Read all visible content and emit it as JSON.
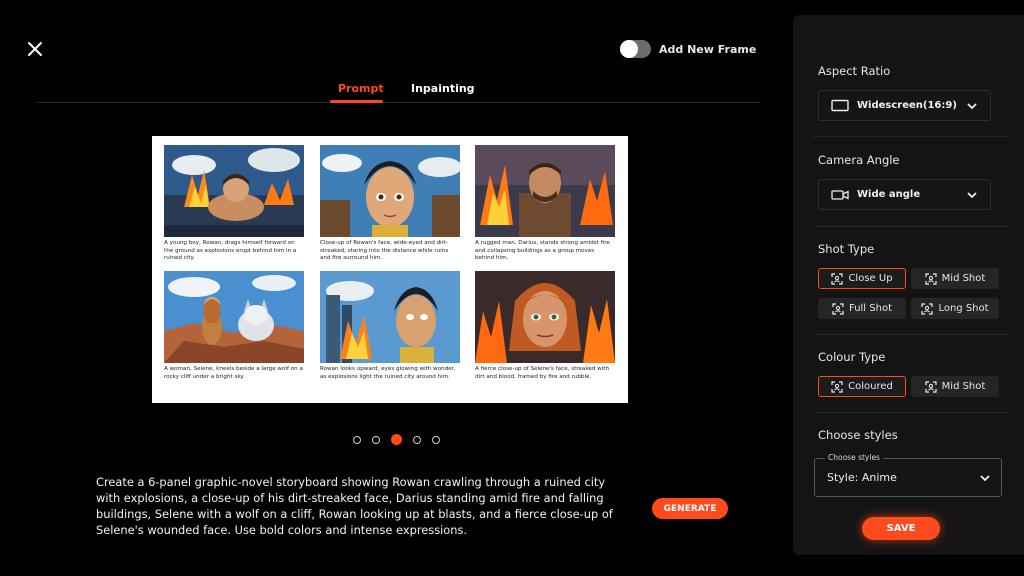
{
  "header": {
    "toggle_label": "Add New Frame",
    "toggle_on": false
  },
  "tabs": [
    {
      "label": "Prompt",
      "active": true
    },
    {
      "label": "Inpainting",
      "active": false
    }
  ],
  "storyboard": {
    "panels": [
      {
        "caption": "A young boy, Rowan, drags himself forward on the ground as explosions erupt behind him in a ruined city.",
        "icon": "boy-crawling-explosion-image"
      },
      {
        "caption": "Close-up of Rowan's face, wide-eyed and dirt-streaked, staring into the distance while ruins and fire surround him.",
        "icon": "boy-face-closeup-image"
      },
      {
        "caption": "A rugged man, Darius, stands strong amidst fire and collapsing buildings as a group moves behind him.",
        "icon": "rugged-man-fire-image"
      },
      {
        "caption": "A woman, Selene, kneels beside a large wolf on a rocky cliff under a bright sky.",
        "icon": "woman-wolf-cliff-image"
      },
      {
        "caption": "Rowan looks upward, eyes glowing with wonder, as explosions light the ruined city around him.",
        "icon": "boy-looking-up-image"
      },
      {
        "caption": "A fierce close-up of Selene's face, streaked with dirt and blood, framed by fire and rubble.",
        "icon": "woman-face-closeup-image"
      }
    ]
  },
  "pagination": {
    "count": 5,
    "active_index": 2
  },
  "prompt": {
    "text": "Create a 6-panel graphic-novel storyboard showing Rowan crawling through a ruined city with explosions, a close-up of his dirt-streaked face, Darius standing amid fire and falling buildings, Selene with a wolf on a cliff, Rowan looking up at blasts, and a fierce close-up of Selene's wounded face. Use bold colors and intense expressions."
  },
  "generate_label": "GENERATE",
  "sidebar": {
    "aspect_ratio": {
      "title": "Aspect Ratio",
      "value": "Widescreen(16:9)",
      "icon": "widescreen-icon"
    },
    "camera_angle": {
      "title": "Camera Angle",
      "value": "Wide angle",
      "icon": "camera-icon"
    },
    "shot_type": {
      "title": "Shot Type",
      "options": [
        {
          "label": "Close Up",
          "selected": true
        },
        {
          "label": "Mid Shot",
          "selected": false
        },
        {
          "label": "Full Shot",
          "selected": false
        },
        {
          "label": "Long Shot",
          "selected": false
        }
      ]
    },
    "colour_type": {
      "title": "Colour Type",
      "options": [
        {
          "label": "Coloured",
          "selected": true
        },
        {
          "label": "Mid Shot",
          "selected": false
        }
      ]
    },
    "styles": {
      "title": "Choose styles",
      "legend": "Choose styles",
      "value": "Style: Anime"
    },
    "save_label": "SAVE"
  },
  "colors": {
    "accent": "#ff4a1c",
    "panel_bg": "#141414",
    "chip_bg": "#252525"
  }
}
